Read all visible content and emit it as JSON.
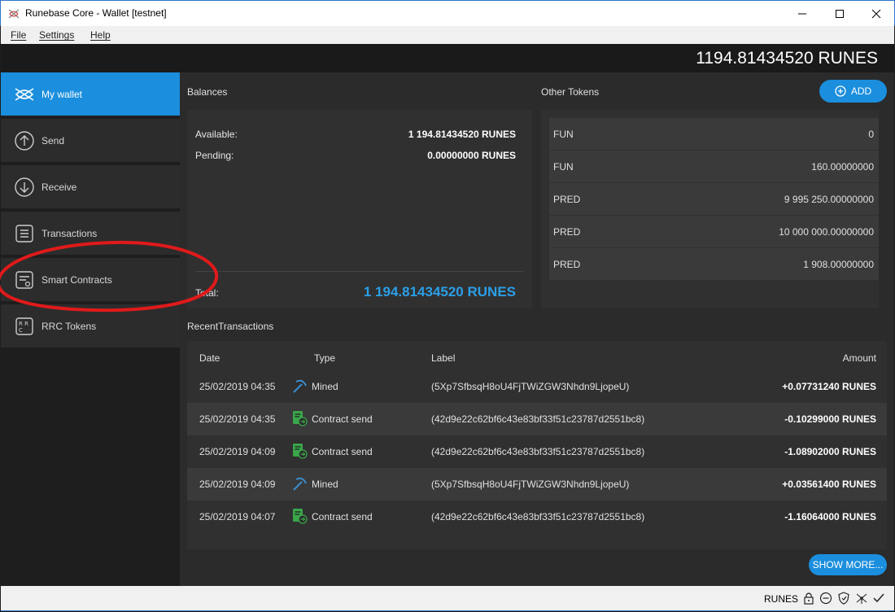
{
  "window": {
    "title": "Runebase Core - Wallet [testnet]",
    "controls": {
      "minimize": "minimize",
      "maximize": "maximize",
      "close": "close"
    }
  },
  "menu": [
    {
      "label": "File"
    },
    {
      "label": "Settings"
    },
    {
      "label": "Help"
    }
  ],
  "header": {
    "balance": "1194.81434520 RUNES"
  },
  "sidebar": {
    "items": [
      {
        "label": "My wallet",
        "icon": "wallet-icon",
        "active": true
      },
      {
        "label": "Send",
        "icon": "arrow-up-circle-icon"
      },
      {
        "label": "Receive",
        "icon": "arrow-down-circle-icon"
      },
      {
        "label": "Transactions",
        "icon": "list-icon"
      },
      {
        "label": "Smart Contracts",
        "icon": "contract-icon"
      },
      {
        "label": "RRC Tokens",
        "icon": "rrc-token-icon"
      }
    ]
  },
  "balances": {
    "title": "Balances",
    "available_label": "Available:",
    "available_value": "1 194.81434520 RUNES",
    "pending_label": "Pending:",
    "pending_value": "0.00000000 RUNES",
    "total_label": "Total:",
    "total_value": "1 194.81434520 RUNES"
  },
  "tokens": {
    "title": "Other Tokens",
    "add_label": "ADD",
    "rows": [
      {
        "name": "FUN",
        "value": "0"
      },
      {
        "name": "FUN",
        "value": "160.00000000"
      },
      {
        "name": "PRED",
        "value": "9 995 250.00000000"
      },
      {
        "name": "PRED",
        "value": "10 000 000.00000000"
      },
      {
        "name": "PRED",
        "value": "1 908.00000000"
      }
    ]
  },
  "recent": {
    "title": "RecentTransactions",
    "columns": {
      "date": "Date",
      "type": "Type",
      "label": "Label",
      "amount": "Amount"
    },
    "rows": [
      {
        "date": "25/02/2019 04:35",
        "type": "Mined",
        "icon": "pickaxe-icon",
        "label": "(5Xp7SfbsqH8oU4FjTWiZGW3Nhdn9LjopeU)",
        "amount": "+0.07731240 RUNES"
      },
      {
        "date": "25/02/2019 04:35",
        "type": "Contract send",
        "icon": "contract-send-icon",
        "label": "(42d9e22c62bf6c43e83bf33f51c23787d2551bc8)",
        "amount": "-0.10299000 RUNES"
      },
      {
        "date": "25/02/2019 04:09",
        "type": "Contract send",
        "icon": "contract-send-icon",
        "label": "(42d9e22c62bf6c43e83bf33f51c23787d2551bc8)",
        "amount": "-1.08902000 RUNES"
      },
      {
        "date": "25/02/2019 04:09",
        "type": "Mined",
        "icon": "pickaxe-icon",
        "label": "(5Xp7SfbsqH8oU4FjTWiZGW3Nhdn9LjopeU)",
        "amount": "+0.03561400 RUNES"
      },
      {
        "date": "25/02/2019 04:07",
        "type": "Contract send",
        "icon": "contract-send-icon",
        "label": "(42d9e22c62bf6c43e83bf33f51c23787d2551bc8)",
        "amount": "-1.16064000 RUNES"
      }
    ],
    "show_more_label": "SHOW MORE..."
  },
  "status": {
    "unit": "RUNES",
    "icons": [
      "lock-icon",
      "minus-circle-icon",
      "shield-icon",
      "network-icon",
      "checkmark-icon"
    ]
  },
  "colors": {
    "accent": "#1b8ede",
    "total": "#2a9fe8",
    "annotation": "#e01a1a"
  }
}
